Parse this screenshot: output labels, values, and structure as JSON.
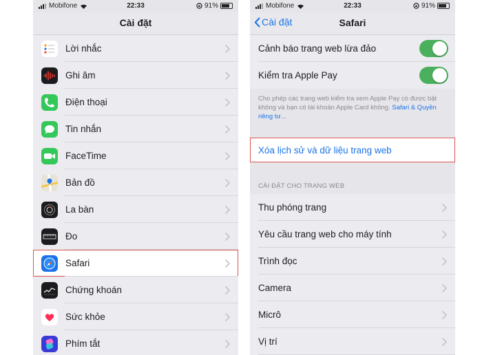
{
  "status_bar": {
    "carrier": "Mobifone",
    "time": "22:33",
    "battery": "91%"
  },
  "left_screen": {
    "title": "Cài đặt",
    "items": [
      {
        "label": "Lời nhắc",
        "icon": "reminders-icon",
        "color": "#ffffff"
      },
      {
        "label": "Ghi âm",
        "icon": "voice-memos-icon",
        "color": "#1c1c1e"
      },
      {
        "label": "Điện thoại",
        "icon": "phone-icon",
        "color": "#34c759"
      },
      {
        "label": "Tin nhắn",
        "icon": "messages-icon",
        "color": "#34c759"
      },
      {
        "label": "FaceTime",
        "icon": "facetime-icon",
        "color": "#34c759"
      },
      {
        "label": "Bản đồ",
        "icon": "maps-icon",
        "color": "#e8e3d6"
      },
      {
        "label": "La bàn",
        "icon": "compass-icon",
        "color": "#1c1c1e"
      },
      {
        "label": "Đo",
        "icon": "measure-icon",
        "color": "#1c1c1e"
      },
      {
        "label": "Safari",
        "icon": "safari-icon",
        "color": "#1a73e8"
      },
      {
        "label": "Chứng khoán",
        "icon": "stocks-icon",
        "color": "#1c1c1e"
      },
      {
        "label": "Sức khỏe",
        "icon": "health-icon",
        "color": "#ffffff"
      },
      {
        "label": "Phím tắt",
        "icon": "shortcuts-icon",
        "color": "#3a3ad6"
      }
    ]
  },
  "right_screen": {
    "back_label": "Cài đặt",
    "title": "Safari",
    "toggle_rows": [
      {
        "label": "Cảnh báo trang web lừa đảo",
        "on": true
      },
      {
        "label": "Kiểm tra Apple Pay",
        "on": true
      }
    ],
    "footnote": "Cho phép các trang web kiểm tra xem Apple Pay có được bật không và bạn có tài khoản Apple Card không.",
    "footnote_link": "Safari & Quyền riêng tư...",
    "clear_history": "Xóa lịch sử và dữ liệu trang web",
    "section_header": "CÀI ĐẶT CHO TRANG WEB",
    "items": [
      {
        "label": "Thu phóng trang"
      },
      {
        "label": "Yêu cầu trang web cho máy tính"
      },
      {
        "label": "Trình đọc"
      },
      {
        "label": "Camera"
      },
      {
        "label": "Micrô"
      },
      {
        "label": "Vị trí"
      }
    ]
  }
}
